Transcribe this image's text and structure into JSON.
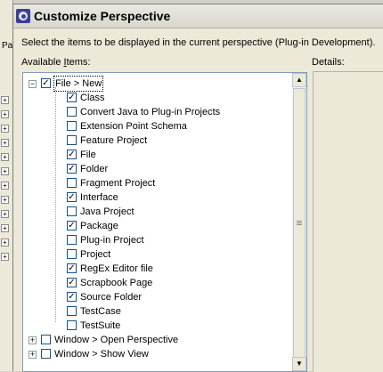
{
  "window": {
    "title": "Customize Perspective",
    "instruction": "Select the items to be displayed in the current perspective (Plug-in Development).",
    "available_label_prefix": "Available ",
    "available_label_mnemonic": "I",
    "available_label_suffix": "tems:",
    "details_label": "Details:"
  },
  "background": {
    "tab_text": "Pa"
  },
  "tree": {
    "items": [
      {
        "label": "File > New",
        "checked": true,
        "level": 0,
        "expanded": true,
        "selected": true
      },
      {
        "label": "Class",
        "checked": true,
        "level": 1
      },
      {
        "label": "Convert Java to Plug-in Projects",
        "checked": false,
        "level": 1
      },
      {
        "label": "Extension Point Schema",
        "checked": false,
        "level": 1
      },
      {
        "label": "Feature Project",
        "checked": false,
        "level": 1
      },
      {
        "label": "File",
        "checked": true,
        "level": 1
      },
      {
        "label": "Folder",
        "checked": true,
        "level": 1
      },
      {
        "label": "Fragment Project",
        "checked": false,
        "level": 1
      },
      {
        "label": "Interface",
        "checked": true,
        "level": 1
      },
      {
        "label": "Java Project",
        "checked": false,
        "level": 1
      },
      {
        "label": "Package",
        "checked": true,
        "level": 1
      },
      {
        "label": "Plug-in Project",
        "checked": false,
        "level": 1
      },
      {
        "label": "Project",
        "checked": false,
        "level": 1
      },
      {
        "label": "RegEx Editor file",
        "checked": true,
        "level": 1
      },
      {
        "label": "Scrapbook Page",
        "checked": true,
        "level": 1
      },
      {
        "label": "Source Folder",
        "checked": true,
        "level": 1
      },
      {
        "label": "TestCase",
        "checked": false,
        "level": 1
      },
      {
        "label": "TestSuite",
        "checked": false,
        "level": 1
      },
      {
        "label": "Window > Open Perspective",
        "checked": false,
        "level": 0,
        "expanded": false
      },
      {
        "label": "Window > Show View",
        "checked": false,
        "level": 0,
        "expanded": false
      }
    ]
  },
  "icons": {
    "app": "eclipse-icon",
    "expand_open": "minus-icon",
    "expand_closed": "plus-icon"
  },
  "colors": {
    "accent_border": "#7f9db9",
    "check": "#000000",
    "dialog_bg": "#ece9d8"
  }
}
